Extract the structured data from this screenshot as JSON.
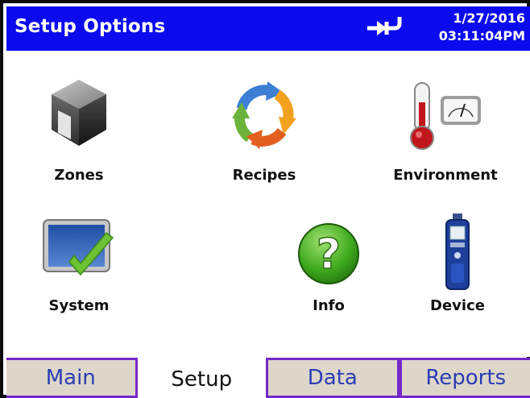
{
  "header": {
    "title": "Setup Options",
    "date": "1/27/2016",
    "time": "03:11:04PM",
    "connection_icon": "usb-connected-icon",
    "background_color": "#0b0bee"
  },
  "tiles": [
    {
      "label": "Zones",
      "icon": "zones-cube-icon"
    },
    {
      "label": "Recipes",
      "icon": "recipes-cycle-icon"
    },
    {
      "label": "Environment",
      "icon": "environment-thermometer-icon"
    },
    {
      "label": "System",
      "icon": "system-monitor-check-icon"
    },
    {
      "label": "Info",
      "icon": "info-question-icon"
    },
    {
      "label": "Device",
      "icon": "device-handheld-icon"
    }
  ],
  "tabs": [
    {
      "label": "Main",
      "active": false
    },
    {
      "label": "Setup",
      "active": true
    },
    {
      "label": "Data",
      "active": false
    },
    {
      "label": "Reports",
      "active": false
    }
  ],
  "colors": {
    "tab_inactive_bg": "#ddd6c9",
    "tab_border": "#7428c8",
    "tab_inactive_text": "#2a3db3"
  }
}
